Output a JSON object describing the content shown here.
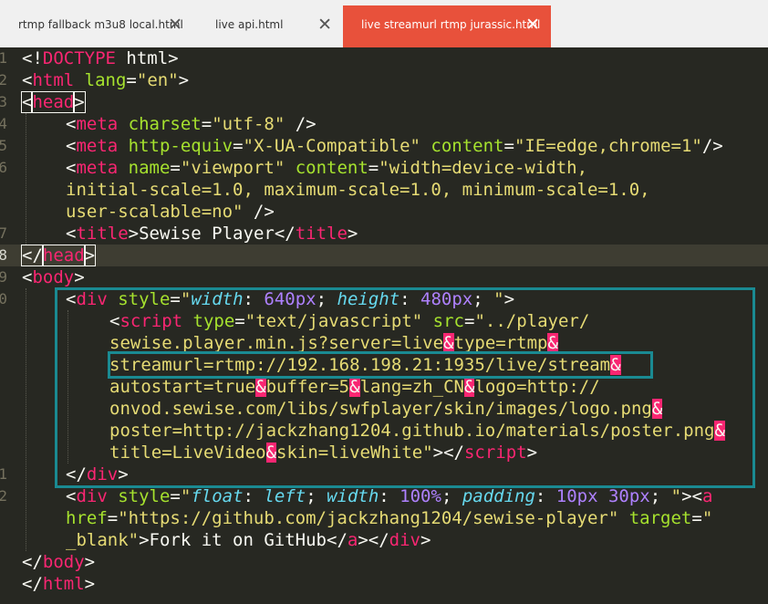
{
  "tabs": [
    {
      "label": "rtmp fallback m3u8 local.html",
      "close": "✕",
      "active": false
    },
    {
      "label": "live api.html",
      "close": "✕",
      "active": false
    },
    {
      "label": "live streamurl rtmp jurassic.html",
      "close": "✕",
      "active": true
    }
  ],
  "gutter": {
    "numbers": [
      "1",
      "2",
      "3",
      "4",
      "5",
      "6",
      "7",
      "8",
      "9",
      "0",
      "1",
      "2"
    ]
  },
  "code": {
    "l1": [
      "<!",
      "DOCTYPE",
      " html",
      ">"
    ],
    "l2": [
      "<",
      "html",
      " lang",
      "=",
      "\"en\"",
      ">"
    ],
    "l3": [
      "<",
      "head",
      ">"
    ],
    "l4": [
      "<",
      "meta",
      " charset",
      "=",
      "\"utf-8\"",
      " />"
    ],
    "l5": [
      "<",
      "meta",
      " http-equiv",
      "=",
      "\"X-UA-Compatible\"",
      " content",
      "=",
      "\"IE=edge,chrome=1\"",
      "/>"
    ],
    "l6": [
      "<",
      "meta",
      " name",
      "=",
      "\"viewport\"",
      " content",
      "=",
      "\"width=device-width,"
    ],
    "l7": "initial-scale=1.0, maximum-scale=1.0, minimum-scale=1.0,",
    "l8": [
      "user-scalable=no\"",
      " />"
    ],
    "l9": [
      "<",
      "title",
      ">",
      "Sewise Player",
      "</",
      "title",
      ">"
    ],
    "l10": [
      "</",
      "head",
      ">"
    ],
    "l11": [
      "<",
      "body",
      ">"
    ],
    "l12": [
      "<",
      "div",
      " style",
      "=",
      "\"",
      "width",
      ": ",
      "640px",
      "; ",
      "height",
      ": ",
      "480px",
      "; ",
      "\"",
      ">"
    ],
    "l13": [
      "<",
      "script",
      " type",
      "=",
      "\"text/javascript\"",
      " src",
      "=",
      "\"../player/"
    ],
    "l14": [
      "sewise.player.min.js?server=live",
      "&",
      "type=rtmp",
      "&"
    ],
    "l15": [
      "streamurl=rtmp://192.168.198.21:1935/live/stream",
      "&"
    ],
    "l16": [
      "autostart=true",
      "&",
      "buffer=5",
      "&",
      "lang=zh_CN",
      "&",
      "logo=http://"
    ],
    "l17": [
      "onvod.sewise.com/libs/swfplayer/skin/images/logo.png",
      "&"
    ],
    "l18": [
      "poster=http://jackzhang1204.github.io/materials/poster.png",
      "&"
    ],
    "l19": [
      "title=LiveVideo",
      "&",
      "skin=liveWhite\"",
      "></",
      "script",
      ">"
    ],
    "l20": [
      "</",
      "div",
      ">"
    ],
    "l21": [
      "<",
      "div",
      " style",
      "=",
      "\"",
      "float",
      ": ",
      "left",
      "; ",
      "width",
      ": ",
      "100%",
      "; ",
      "padding",
      ": ",
      "10px 30px",
      "; ",
      "\"",
      "><",
      "a"
    ],
    "l22": [
      "href",
      "=",
      "\"https://github.com/jackzhang1204/sewise-player\"",
      " target",
      "=",
      "\""
    ],
    "l23": [
      "_blank\"",
      ">",
      "Fork it on GitHub",
      "</",
      "a",
      "></",
      "div",
      ">"
    ],
    "l24": [
      "</",
      "body",
      ">"
    ],
    "l25": [
      "</",
      "html",
      ">"
    ]
  },
  "highlight_colors": {
    "annotation_box": "#1a8a92",
    "ampersand": "#f92672",
    "tag": "#f92672",
    "attribute": "#a6e22e",
    "string": "#e6db74"
  }
}
